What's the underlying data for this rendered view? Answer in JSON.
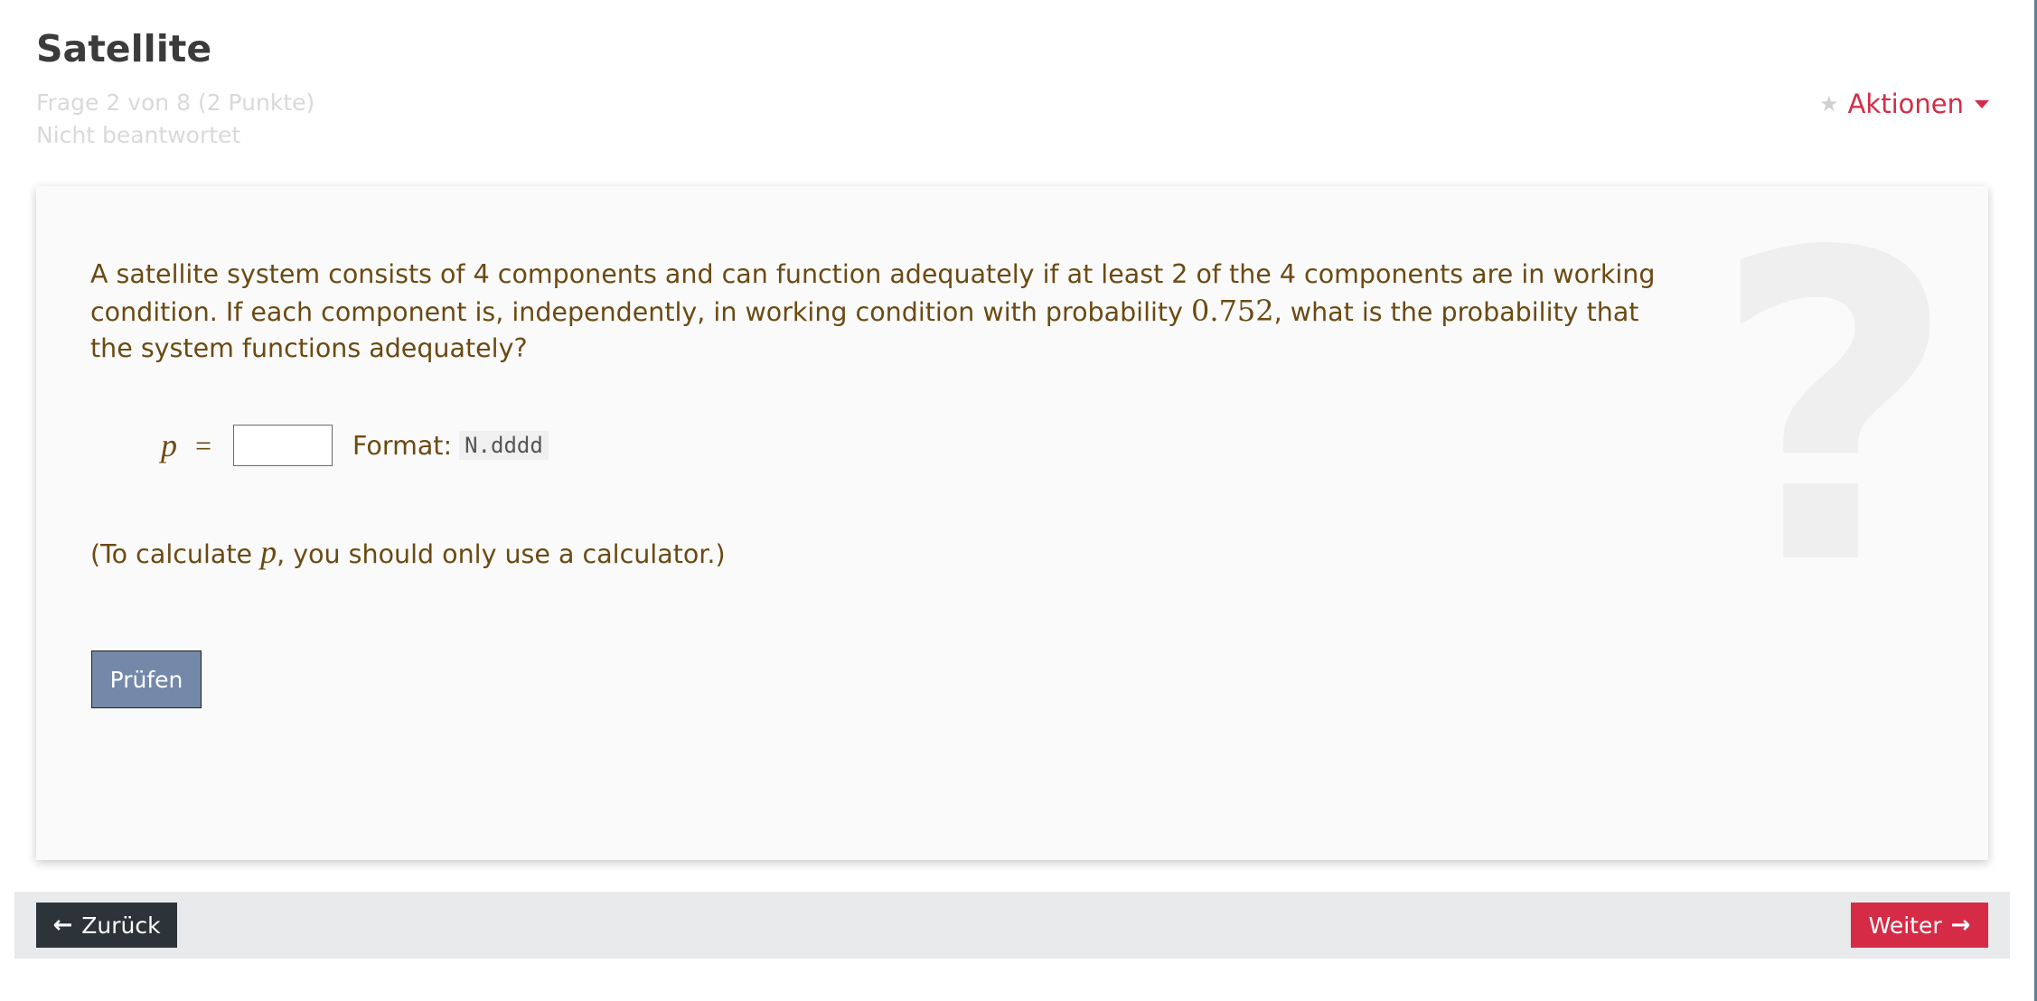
{
  "page": {
    "title": "Satellite",
    "question_info": "Frage 2 von 8 (2 Punkte)",
    "status": "Nicht beantwortet",
    "actions_label": "Aktionen"
  },
  "question": {
    "text_part1": "A satellite system consists of 4 components and can function adequately if at least 2 of the 4 components are in working condition. If each component is, independently, in working condition with probability ",
    "probability": "0.752",
    "text_part2": ", what is the probability that the system functions adequately?",
    "answer_var": "p",
    "equals": "=",
    "answer_value": "",
    "format_label": "Format:",
    "format_code": "N.dddd",
    "hint_prefix": "(To calculate ",
    "hint_var": "p",
    "hint_suffix": ", you should only use a calculator.)",
    "check_label": "Prüfen",
    "watermark": "?"
  },
  "nav": {
    "back_label": "Zurück",
    "next_label": "Weiter"
  },
  "colors": {
    "accent": "#d52b47",
    "question_text": "#6b4a12",
    "check_button": "#7489a9",
    "back_button": "#2c3439"
  }
}
